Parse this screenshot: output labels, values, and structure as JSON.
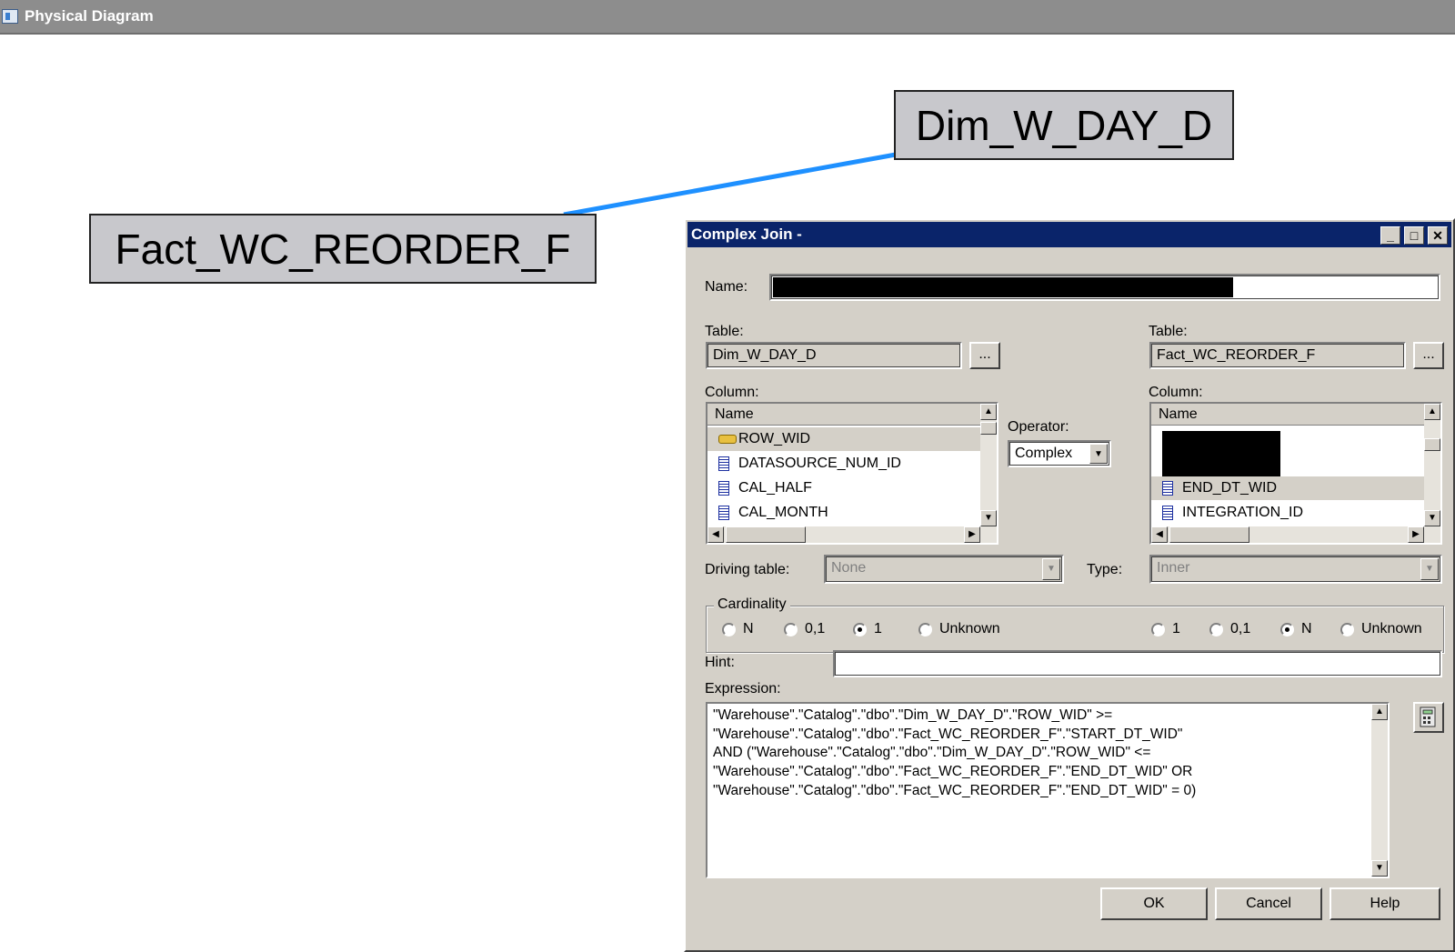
{
  "window": {
    "title": "Physical Diagram"
  },
  "diagram": {
    "tables": [
      {
        "name": "Dim_W_DAY_D"
      },
      {
        "name": "Fact_WC_REORDER_F"
      }
    ],
    "join_color": "#1e90ff"
  },
  "dialog": {
    "title": "Complex Join -",
    "name_label": "Name:",
    "left": {
      "table_label": "Table:",
      "table_value": "Dim_W_DAY_D",
      "browse_label": "...",
      "column_label": "Column:",
      "header": "Name",
      "rows": [
        {
          "label": "ROW_WID",
          "icon": "key-icon"
        },
        {
          "label": "DATASOURCE_NUM_ID",
          "icon": "column-icon"
        },
        {
          "label": "CAL_HALF",
          "icon": "column-icon"
        },
        {
          "label": "CAL_MONTH",
          "icon": "column-icon"
        }
      ]
    },
    "operator": {
      "label": "Operator:",
      "value": "Complex"
    },
    "right": {
      "table_label": "Table:",
      "table_value": "Fact_WC_REORDER_F",
      "browse_label": "...",
      "column_label": "Column:",
      "header": "Name",
      "rows": [
        {
          "label": "END_DT_WID",
          "icon": "column-icon"
        },
        {
          "label": "INTEGRATION_ID",
          "icon": "column-icon"
        }
      ]
    },
    "driving_table": {
      "label": "Driving table:",
      "value": "None"
    },
    "type": {
      "label": "Type:",
      "value": "Inner"
    },
    "cardinality": {
      "label": "Cardinality",
      "left_options": [
        {
          "label": "N",
          "selected": false
        },
        {
          "label": "0,1",
          "selected": false
        },
        {
          "label": "1",
          "selected": true
        },
        {
          "label": "Unknown",
          "selected": false
        }
      ],
      "right_options": [
        {
          "label": "1",
          "selected": false
        },
        {
          "label": "0,1",
          "selected": false
        },
        {
          "label": "N",
          "selected": true
        },
        {
          "label": "Unknown",
          "selected": false
        }
      ]
    },
    "hint": {
      "label": "Hint:",
      "value": ""
    },
    "expression": {
      "label": "Expression:",
      "lines": [
        "\"Warehouse\".\"Catalog\".\"dbo\".\"Dim_W_DAY_D\".\"ROW_WID\" >=",
        "\"Warehouse\".\"Catalog\".\"dbo\".\"Fact_WC_REORDER_F\".\"START_DT_WID\"",
        "AND (\"Warehouse\".\"Catalog\".\"dbo\".\"Dim_W_DAY_D\".\"ROW_WID\" <=",
        "\"Warehouse\".\"Catalog\".\"dbo\".\"Fact_WC_REORDER_F\".\"END_DT_WID\" OR",
        "\"Warehouse\".\"Catalog\".\"dbo\".\"Fact_WC_REORDER_F\".\"END_DT_WID\" = 0)"
      ]
    },
    "buttons": {
      "ok": "OK",
      "cancel": "Cancel",
      "help": "Help"
    },
    "title_buttons": {
      "minimize": "_",
      "maximize": "□",
      "close": "✕"
    }
  }
}
